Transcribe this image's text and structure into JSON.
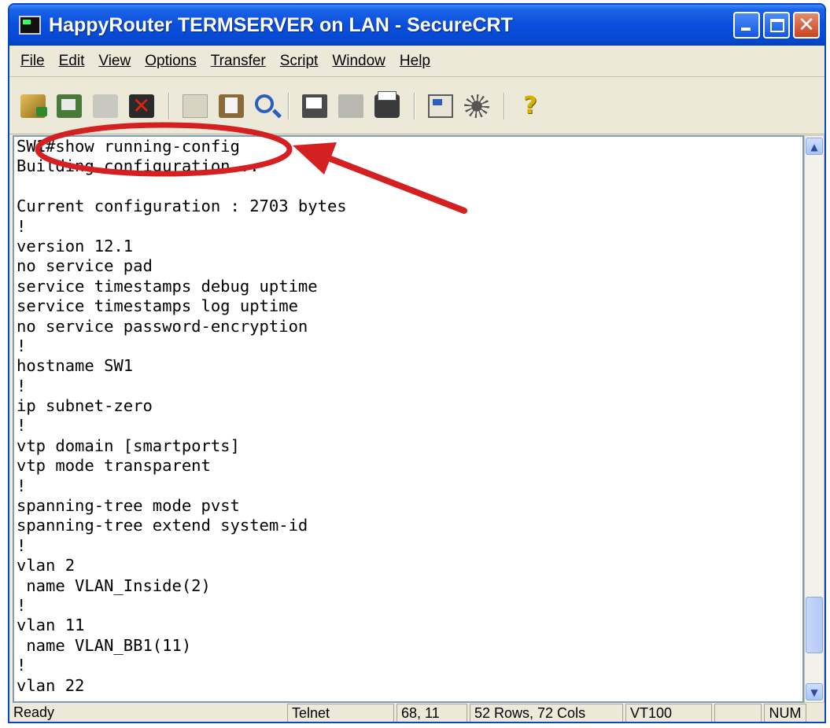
{
  "window": {
    "title": "HappyRouter TERMSERVER on LAN - SecureCRT"
  },
  "menu": {
    "items": [
      "File",
      "Edit",
      "View",
      "Options",
      "Transfer",
      "Script",
      "Window",
      "Help"
    ]
  },
  "toolbar": {
    "icons": [
      "connect-icon",
      "quick-connect-icon",
      "reconnect-icon",
      "disconnect-icon",
      "copy-icon",
      "paste-icon",
      "find-icon",
      "print-icon",
      "print-selection-icon",
      "printer-setup-icon",
      "session-options-icon",
      "global-options-icon",
      "help-icon"
    ]
  },
  "terminal": {
    "lines": [
      "SW1#show running-config",
      "Building configuration...",
      "",
      "Current configuration : 2703 bytes",
      "!",
      "version 12.1",
      "no service pad",
      "service timestamps debug uptime",
      "service timestamps log uptime",
      "no service password-encryption",
      "!",
      "hostname SW1",
      "!",
      "ip subnet-zero",
      "!",
      "vtp domain [smartports]",
      "vtp mode transparent",
      "!",
      "spanning-tree mode pvst",
      "spanning-tree extend system-id",
      "!",
      "vlan 2",
      " name VLAN_Inside(2)",
      "!",
      "vlan 11",
      " name VLAN_BB1(11)",
      "!",
      "vlan 22"
    ]
  },
  "status": {
    "ready": "Ready",
    "protocol": "Telnet",
    "cursor": "68, 11",
    "size": "52 Rows,  72 Cols",
    "emulation": "VT100",
    "blank": "",
    "num": "NUM"
  },
  "colors": {
    "titlebar": "#0a4fdc",
    "annotation": "#d42020"
  }
}
